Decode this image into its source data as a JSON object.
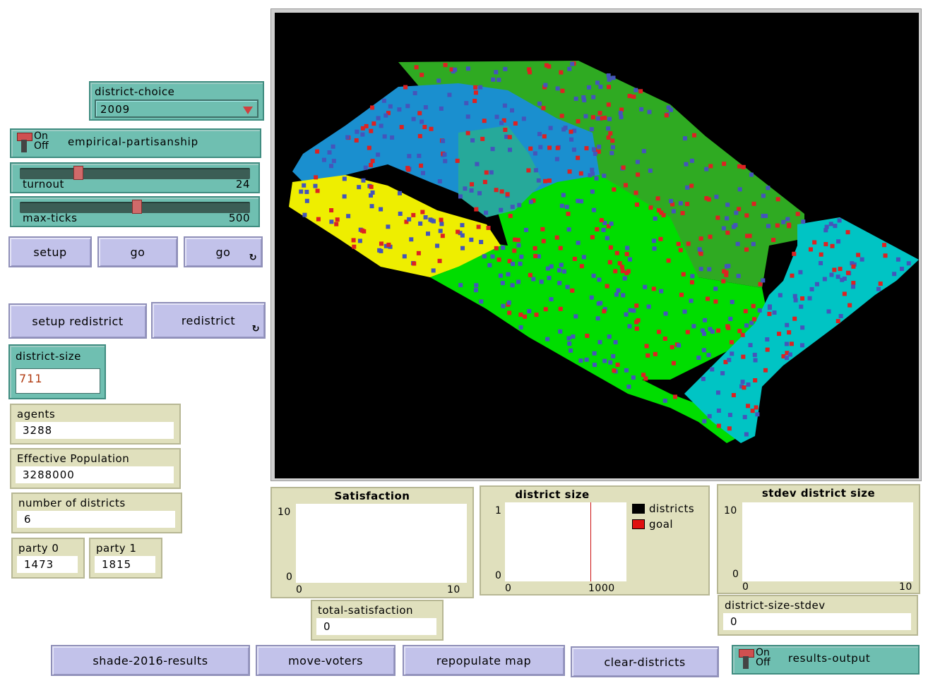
{
  "chooser": {
    "label": "district-choice",
    "value": "2009"
  },
  "switch_empirical": {
    "on": "On",
    "off": "Off",
    "label": "empirical-partisanship"
  },
  "slider_turnout": {
    "label": "turnout",
    "value": "24",
    "level": 0.24
  },
  "slider_maxticks": {
    "label": "max-ticks",
    "value": "500",
    "level": 0.5
  },
  "buttons": {
    "setup": "setup",
    "go_once": "go",
    "go_forever": "go",
    "setup_redistrict": "setup redistrict",
    "redistrict": "redistrict",
    "shade": "shade-2016-results",
    "move_voters": "move-voters",
    "repopulate": "repopulate map",
    "clear_districts": "clear-districts"
  },
  "input_district_size": {
    "label": "district-size",
    "value": "711"
  },
  "monitors": {
    "agents": {
      "label": "agents",
      "value": "3288"
    },
    "effective_population": {
      "label": "Effective Population",
      "value": "3288000"
    },
    "number_of_districts": {
      "label": "number of districts",
      "value": "6"
    },
    "party0": {
      "label": "party 0",
      "value": "1473"
    },
    "party1": {
      "label": "party 1",
      "value": "1815"
    },
    "total_satisfaction": {
      "label": "total-satisfaction",
      "value": "0"
    },
    "district_size_stdev": {
      "label": "district-size-stdev",
      "value": "0"
    }
  },
  "switch_results": {
    "on": "On",
    "off": "Off",
    "label": "results-output"
  },
  "plots": {
    "satisfaction": {
      "title": "Satisfaction",
      "ymax": "10",
      "ymin": "0",
      "xmin": "0",
      "xmax": "10"
    },
    "district_size": {
      "title": "district size",
      "ymax": "1",
      "ymin": "0",
      "xmin": "0",
      "xmax": "1000",
      "legend": [
        {
          "name": "districts",
          "color": "#000000"
        },
        {
          "name": "goal",
          "color": "#e01010"
        }
      ]
    },
    "stdev_district_size": {
      "title": "stdev district size",
      "ymax": "10",
      "ymin": "0",
      "xmin": "0",
      "xmax": "10"
    }
  },
  "colors": {
    "teal_widget": "#6fbfb1",
    "button": "#c2c2ea",
    "monitor": "#e0e0bd",
    "goal_line": "#cc1111"
  },
  "view": {
    "background": "#000000",
    "district_colors": [
      "#2faa22",
      "#1a8fcf",
      "#eeee00",
      "#00dd00",
      "#00c4c4",
      "#26a99a"
    ],
    "agent_colors": [
      "#dd2222",
      "#4455bb"
    ]
  }
}
